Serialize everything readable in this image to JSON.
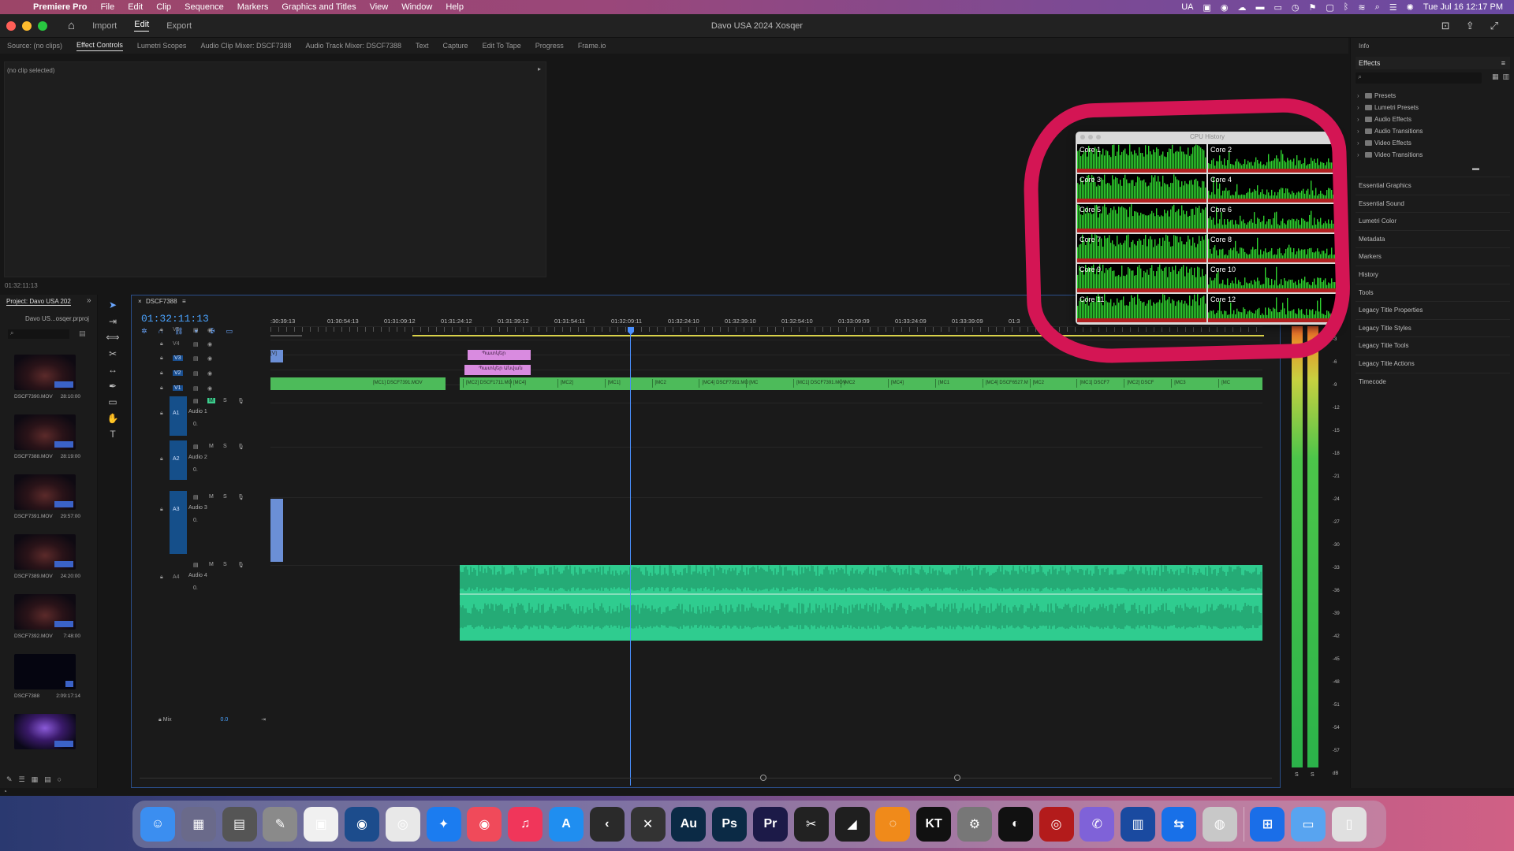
{
  "menubar": {
    "app": "Premiere Pro",
    "items": [
      "File",
      "Edit",
      "Clip",
      "Sequence",
      "Markers",
      "Graphics and Titles",
      "View",
      "Window",
      "Help"
    ],
    "input_source": "UA",
    "clock": "Tue Jul 16  12:17 PM"
  },
  "header": {
    "tabs": [
      "Import",
      "Edit",
      "Export"
    ],
    "active_tab": "Edit",
    "project_title": "Davo USA 2024 Xosqer"
  },
  "source_panel": {
    "tabs": [
      "Source: (no clips)",
      "Effect Controls",
      "Lumetri Scopes",
      "Audio Clip Mixer: DSCF7388",
      "Audio Track Mixer: DSCF7388",
      "Text",
      "Capture",
      "Edit To Tape",
      "Progress",
      "Frame.io"
    ],
    "active_tab": "Effect Controls",
    "no_clip_text": "(no clip selected)",
    "timecode": "01:32:11:13"
  },
  "right_panel": {
    "info_tab": "Info",
    "effects_title": "Effects",
    "tree": [
      "Presets",
      "Lumetri Presets",
      "Audio Effects",
      "Audio Transitions",
      "Video Effects",
      "Video Transitions"
    ],
    "sections": [
      "Essential Graphics",
      "Essential Sound",
      "Lumetri Color",
      "Metadata",
      "Markers",
      "History",
      "Tools",
      "Legacy Title Properties",
      "Legacy Title Styles",
      "Legacy Title Tools",
      "Legacy Title Actions",
      "Timecode"
    ]
  },
  "project": {
    "title": "Project: Davo USA 202",
    "file": "Davo US...osqer.prproj",
    "clips": [
      {
        "name": "DSCF7390.MOV",
        "duration": "28:10:00"
      },
      {
        "name": "DSCF7388.MOV",
        "duration": "28:19:00"
      },
      {
        "name": "DSCF7391.MOV",
        "duration": "29:57:00"
      },
      {
        "name": "DSCF7389.MOV",
        "duration": "24:20:00"
      },
      {
        "name": "DSCF7392.MOV",
        "duration": "7:48:00"
      },
      {
        "name": "DSCF7388",
        "duration": "2:09:17:14"
      }
    ]
  },
  "timeline": {
    "sequence": "DSCF7388",
    "timecode": "01:32:11:13",
    "ruler": [
      ":30:39:13",
      "01:30:54:13",
      "01:31:09:12",
      "01:31:24:12",
      "01:31:39:12",
      "01:31:54:11",
      "01:32:09:11",
      "01:32:24:10",
      "01:32:39:10",
      "01:32:54:10",
      "01:33:09:09",
      "01:33:24:09",
      "01:33:39:09",
      "01:3"
    ],
    "video_tracks": [
      "V5",
      "V4",
      "V3",
      "V2",
      "V1"
    ],
    "audio_tracks": [
      {
        "id": "A1",
        "name": "Audio 1"
      },
      {
        "id": "A2",
        "name": "Audio 2"
      },
      {
        "id": "A3",
        "name": "Audio 3"
      },
      {
        "id": "A4",
        "name": "Audio 4"
      }
    ],
    "pink_clips": [
      "Պատկեր",
      "Պատկեր Անվան"
    ],
    "v1_segments": [
      "[MC1] DSCF7391.MOV",
      "[MC2] DSCF1711.MO",
      "[MC4]",
      "[MC2]",
      "[MC1]",
      "[MC2",
      "[MC4] DSCF7391.MO",
      "[MC",
      "[MC1] DSCF7391.MOV",
      "[MC2",
      "[MC4]",
      "[MC1",
      "[MC4] DSCF6527.M",
      "[MC2",
      "[MC1] DSCF7",
      "[MC2] DSCF",
      "[MC3",
      "[MC"
    ],
    "v1_clip_start": "[V]",
    "mix_label": "Mix",
    "mix_value": "0.0",
    "track_button_m": "M",
    "track_button_s": "S",
    "track_level": "0."
  },
  "meters": {
    "db": [
      "-3",
      "-6",
      "-9",
      "-12",
      "-15",
      "-18",
      "-21",
      "-24",
      "-27",
      "-30",
      "-33",
      "-36",
      "-39",
      "-42",
      "-45",
      "-48",
      "-51",
      "-54",
      "-57",
      "dB"
    ],
    "solo_labels": [
      "S",
      "S"
    ]
  },
  "cpu_history": {
    "title": "CPU History",
    "cores": [
      "Core 1",
      "Core 2",
      "Core 3",
      "Core 4",
      "Core 5",
      "Core 6",
      "Core 7",
      "Core 8",
      "Core 9",
      "Core 10",
      "Core 11",
      "Core 12"
    ],
    "annotation_color": "#d41554"
  },
  "dock": {
    "apps": [
      {
        "name": "Finder",
        "color": "#3b8ef0",
        "label": "☺"
      },
      {
        "name": "Launchpad",
        "color": "#6a6a8a",
        "label": "▦"
      },
      {
        "name": "Calculator",
        "color": "#555",
        "label": "▤"
      },
      {
        "name": "Preview",
        "color": "#8a8a8a",
        "label": "✎"
      },
      {
        "name": "Microsoft Store",
        "color": "#f0f0f0",
        "label": "▣"
      },
      {
        "name": "Cinema 4D",
        "color": "#1c4c8c",
        "label": "◉"
      },
      {
        "name": "Chrome",
        "color": "#e8e8e8",
        "label": "◎"
      },
      {
        "name": "Safari",
        "color": "#1b7cf0",
        "label": "✦"
      },
      {
        "name": "Music",
        "color": "#f04a5a",
        "label": "◉"
      },
      {
        "name": "Apple Music",
        "color": "#f0365a",
        "label": "♫"
      },
      {
        "name": "App Store",
        "color": "#1f8ef0",
        "label": "A"
      },
      {
        "name": "Capcut",
        "color": "#2a2a2a",
        "label": "‹"
      },
      {
        "name": "Nuke",
        "color": "#333",
        "label": "✕"
      },
      {
        "name": "Audition",
        "color": "#0b2a45",
        "label": "Au"
      },
      {
        "name": "Photoshop",
        "color": "#0b2a45",
        "label": "Ps"
      },
      {
        "name": "Premiere Pro",
        "color": "#1c1a48",
        "label": "Pr"
      },
      {
        "name": "Final Cut Pro",
        "color": "#222",
        "label": "✂"
      },
      {
        "name": "Logic",
        "color": "#1f1f1f",
        "label": "◢"
      },
      {
        "name": "Motion",
        "color": "#f08a1a",
        "label": "◌"
      },
      {
        "name": "KeyTalk",
        "color": "#111",
        "label": "KT"
      },
      {
        "name": "System Settings",
        "color": "#777",
        "label": "⚙"
      },
      {
        "name": "Activity Monitor",
        "color": "#111",
        "label": "◐"
      },
      {
        "name": "DaVinci",
        "color": "#b31b1b",
        "label": "◎"
      },
      {
        "name": "Viber",
        "color": "#7f62d8",
        "label": "✆"
      },
      {
        "name": "Screens",
        "color": "#1a4aa0",
        "label": "▥"
      },
      {
        "name": "TeamViewer",
        "color": "#1870e8",
        "label": "⇆"
      },
      {
        "name": "Disk Utility",
        "color": "#c8c8c8",
        "label": "◍"
      },
      {
        "name": "Windows App",
        "color": "#1a6ee8",
        "label": "⊞"
      },
      {
        "name": "Downloads",
        "color": "#58a4f0",
        "label": "▭"
      },
      {
        "name": "Trash",
        "color": "#e0e0e0",
        "label": "▯"
      }
    ]
  }
}
